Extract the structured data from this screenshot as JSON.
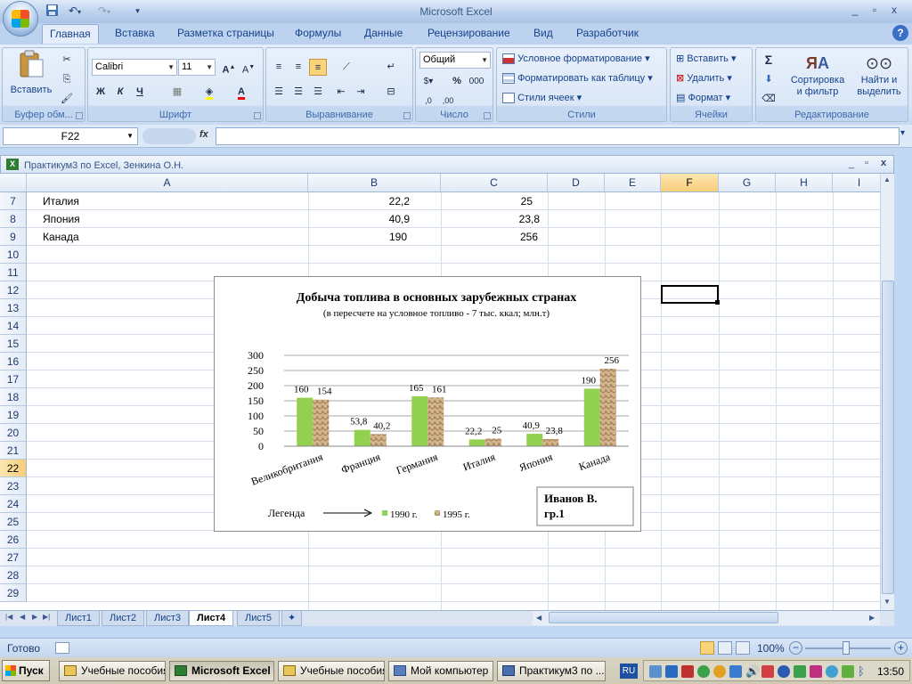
{
  "app": {
    "title": "Microsoft Excel",
    "window_buttons": [
      "_",
      "▫",
      "x"
    ]
  },
  "tabs": [
    "Главная",
    "Вставка",
    "Разметка страницы",
    "Формулы",
    "Данные",
    "Рецензирование",
    "Вид",
    "Разработчик"
  ],
  "active_tab": "Главная",
  "ribbon": {
    "clipboard": {
      "paste": "Вставить",
      "label": "Буфер обм..."
    },
    "font": {
      "name": "Calibri",
      "size": "11",
      "label": "Шрифт",
      "bold": "Ж",
      "italic": "К",
      "underline": "Ч"
    },
    "alignment": {
      "label": "Выравнивание"
    },
    "number": {
      "format": "Общий",
      "label": "Число",
      "percent": "%",
      "thousands": "000"
    },
    "styles": {
      "conditional": "Условное форматирование",
      "as_table": "Форматировать как таблицу",
      "cell_styles": "Стили ячеек",
      "label": "Стили"
    },
    "cells": {
      "insert": "Вставить",
      "delete": "Удалить",
      "format": "Формат",
      "label": "Ячейки"
    },
    "editing": {
      "sort_line1": "Сортировка",
      "sort_line2": "и фильтр",
      "find_line1": "Найти и",
      "find_line2": "выделить",
      "label": "Редактирование"
    }
  },
  "formula_bar": {
    "name_box": "F22",
    "fx": "fx",
    "formula": ""
  },
  "workbook": {
    "title": "Практикум3 по Excel, Зенкина О.Н."
  },
  "grid": {
    "columns": [
      "A",
      "B",
      "C",
      "D",
      "E",
      "F",
      "G",
      "H",
      "I"
    ],
    "rows": [
      "7",
      "8",
      "9",
      "10",
      "11",
      "12",
      "13",
      "14",
      "15",
      "16",
      "17",
      "18",
      "19",
      "20",
      "21",
      "22",
      "23",
      "24",
      "25",
      "26",
      "27",
      "28",
      "29"
    ],
    "selected_column": "F",
    "selected_row": "22",
    "cells": [
      {
        "a": "Италия",
        "b": "22,2",
        "c": "25"
      },
      {
        "a": "Япония",
        "b": "40,9",
        "c": "23,8"
      },
      {
        "a": "Канада",
        "b": "190",
        "c": "256"
      }
    ]
  },
  "chart_data": {
    "type": "bar",
    "title": "Добыча топлива в основных зарубежных странах",
    "subtitle": "(в пересчете на условное топливо  - 7 тыс. ккал; млн.т)",
    "categories": [
      "Великобритания",
      "Франция",
      "Германия",
      "Италия",
      "Япония",
      "Канада"
    ],
    "series": [
      {
        "name": "1990 г.",
        "values": [
          160,
          53.8,
          165,
          22.2,
          40.9,
          190
        ],
        "labels": [
          "160",
          "53,8",
          "165",
          "22,2",
          "40,9",
          "190"
        ],
        "color": "#92d050"
      },
      {
        "name": "1995 г.",
        "values": [
          154,
          40.2,
          161,
          25,
          23.8,
          256
        ],
        "labels": [
          "154",
          "40,2",
          "161",
          "25",
          "23,8",
          "256"
        ],
        "color": "#c8a97a"
      }
    ],
    "y_ticks": [
      "0",
      "50",
      "100",
      "150",
      "200",
      "250",
      "300"
    ],
    "ylim": [
      0,
      300
    ],
    "grid": true,
    "legend_caption": "Легенда",
    "legend_position": "bottom",
    "author_box_line1": "Иванов  В.",
    "author_box_line2": "гр.1"
  },
  "sheets": [
    "Лист1",
    "Лист2",
    "Лист3",
    "Лист4",
    "Лист5"
  ],
  "active_sheet": "Лист4",
  "status": {
    "ready": "Готово",
    "zoom": "100%"
  },
  "taskbar": {
    "start": "Пуск",
    "tasks": [
      "Учебные пособия",
      "Microsoft Excel",
      "Учебные пособия",
      "Мой компьютер",
      "Практикум3 по ..."
    ],
    "active_task": "Microsoft Excel",
    "lang": "RU",
    "clock": "13:50"
  }
}
